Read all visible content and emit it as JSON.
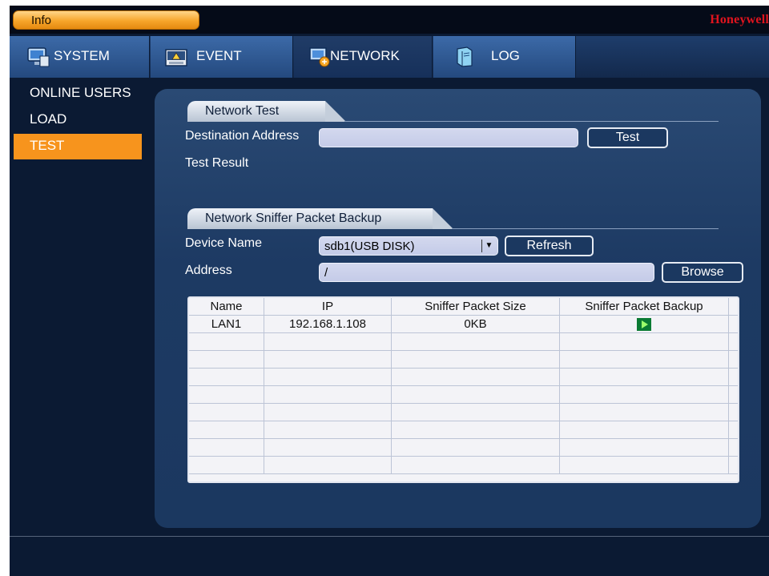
{
  "titlebar": {
    "info_label": "Info",
    "brand": "Honeywell"
  },
  "tabs": [
    {
      "label": "SYSTEM",
      "icon": "monitor-icon"
    },
    {
      "label": "EVENT",
      "icon": "alarm-icon"
    },
    {
      "label": "NETWORK",
      "icon": "network-icon"
    },
    {
      "label": "LOG",
      "icon": "log-book-icon"
    }
  ],
  "sidebar": {
    "items": [
      {
        "label": "ONLINE USERS"
      },
      {
        "label": "LOAD"
      },
      {
        "label": "TEST"
      }
    ]
  },
  "network_test": {
    "title": "Network Test",
    "destination_label": "Destination Address",
    "destination_value": "",
    "test_button": "Test",
    "result_label": "Test Result"
  },
  "sniffer": {
    "title": "Network Sniffer Packet Backup",
    "device_label": "Device Name",
    "device_value": "sdb1(USB DISK)",
    "refresh_button": "Refresh",
    "address_label": "Address",
    "address_value": "/",
    "browse_button": "Browse"
  },
  "table": {
    "columns": [
      "Name",
      "IP",
      "Sniffer Packet Size",
      "Sniffer Packet Backup"
    ],
    "rows": [
      {
        "name": "LAN1",
        "ip": "192.168.1.108",
        "size": "0KB",
        "backup_icon": "play-icon"
      }
    ]
  },
  "colors": {
    "accent": "#f7941d",
    "background": "#0b1a33",
    "brand": "#e0141e",
    "play": "#0a7a33"
  }
}
